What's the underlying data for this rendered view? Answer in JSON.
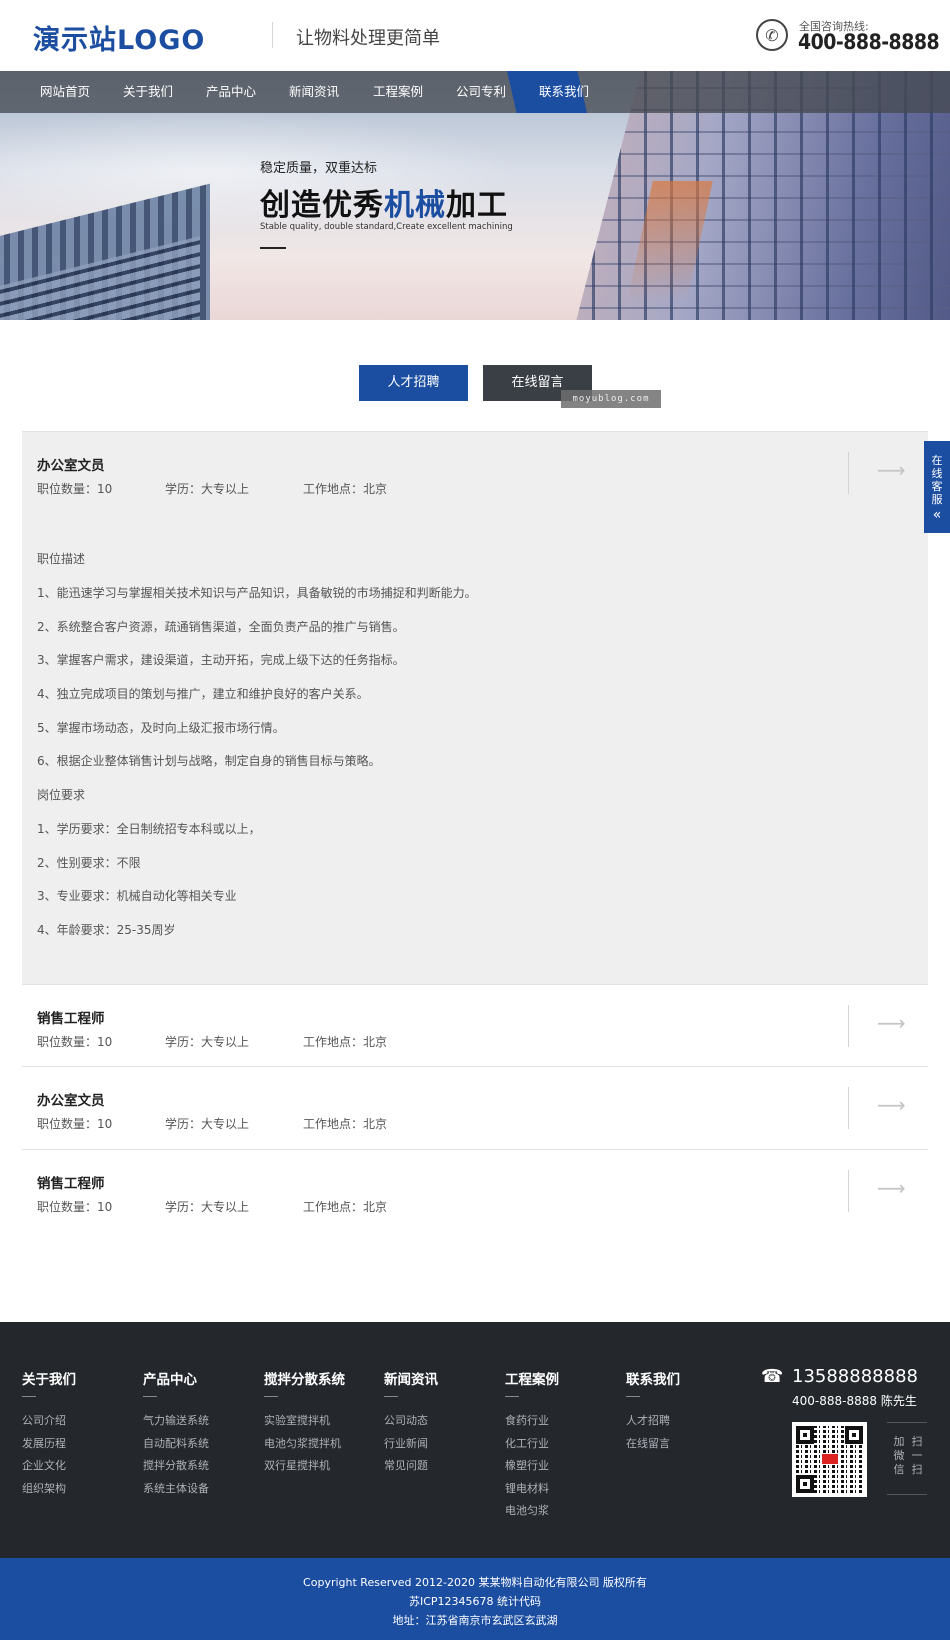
{
  "header": {
    "logo": "演示站LOGO",
    "slogan": "让物料处理更简单",
    "hotline_label": "全国咨询热线:",
    "hotline_number": "400-888-8888"
  },
  "nav": {
    "items": [
      {
        "label": "网站首页"
      },
      {
        "label": "关于我们"
      },
      {
        "label": "产品中心"
      },
      {
        "label": "新闻资讯"
      },
      {
        "label": "工程案例"
      },
      {
        "label": "公司专利"
      },
      {
        "label": "联系我们",
        "active": true
      }
    ]
  },
  "banner": {
    "subtitle": "稳定质量，双重达标",
    "title_part1": "创造优秀",
    "title_highlight": "机械",
    "title_part2": "加工",
    "english": "Stable quality, double standard,Create excellent machining"
  },
  "tabs": {
    "recruit": "人才招聘",
    "message": "在线留言"
  },
  "watermark": "moyublog.com",
  "jobs": [
    {
      "title": "办公室文员",
      "count": "职位数量：10",
      "education": "学历：大专以上",
      "location": "工作地点：北京",
      "expanded": true,
      "desc_heading": "职位描述",
      "desc": [
        "1、能迅速学习与掌握相关技术知识与产品知识，具备敏锐的市场捕捉和判断能力。",
        "2、系统整合客户资源，疏通销售渠道，全面负责产品的推广与销售。",
        "3、掌握客户需求，建设渠道，主动开拓，完成上级下达的任务指标。",
        "4、独立完成项目的策划与推广，建立和维护良好的客户关系。",
        "5、掌握市场动态，及时向上级汇报市场行情。",
        "6、根据企业整体销售计划与战略，制定自身的销售目标与策略。"
      ],
      "req_heading": "岗位要求",
      "req": [
        "1、学历要求：全日制统招专本科或以上，",
        "2、性别要求：不限",
        "3、专业要求：机械自动化等相关专业",
        "4、年龄要求：25-35周岁"
      ]
    },
    {
      "title": "销售工程师",
      "count": "职位数量：10",
      "education": "学历：大专以上",
      "location": "工作地点：北京"
    },
    {
      "title": "办公室文员",
      "count": "职位数量：10",
      "education": "学历：大专以上",
      "location": "工作地点：北京"
    },
    {
      "title": "销售工程师",
      "count": "职位数量：10",
      "education": "学历：大专以上",
      "location": "工作地点：北京"
    }
  ],
  "side_float": {
    "chars": [
      "在",
      "线",
      "客",
      "服"
    ],
    "arrow": "«"
  },
  "footer": {
    "columns": [
      {
        "title": "关于我们",
        "links": [
          "公司介绍",
          "发展历程",
          "企业文化",
          "组织架构"
        ]
      },
      {
        "title": "产品中心",
        "links": [
          "气力输送系统",
          "自动配料系统",
          "搅拌分散系统",
          "系统主体设备"
        ]
      },
      {
        "title": "搅拌分散系统",
        "links": [
          "实验室搅拌机",
          "电池匀浆搅拌机",
          "双行星搅拌机"
        ]
      },
      {
        "title": "新闻资讯",
        "links": [
          "公司动态",
          "行业新闻",
          "常见问题"
        ]
      },
      {
        "title": "工程案例",
        "links": [
          "食药行业",
          "化工行业",
          "橡塑行业",
          "锂电材料",
          "电池匀浆"
        ]
      },
      {
        "title": "联系我们",
        "links": [
          "人才招聘",
          "在线留言"
        ]
      }
    ],
    "mobile": "13588888888",
    "hotline": "400-888-8888 陈先生",
    "scan_cols": [
      [
        "扫",
        "一",
        "扫"
      ],
      [
        "加",
        "微",
        "信"
      ]
    ],
    "qr_badge": "头条"
  },
  "copyright": {
    "line1": "Copyright Reserved 2012-2020 某某物料自动化有限公司 版权所有",
    "line2": "苏ICP12345678 统计代码",
    "line3": "地址：江苏省南京市玄武区玄武湖"
  },
  "colors": {
    "brand": "#1b4da1",
    "footer_bg": "#24282d",
    "nav_active": "#1b4da1"
  }
}
